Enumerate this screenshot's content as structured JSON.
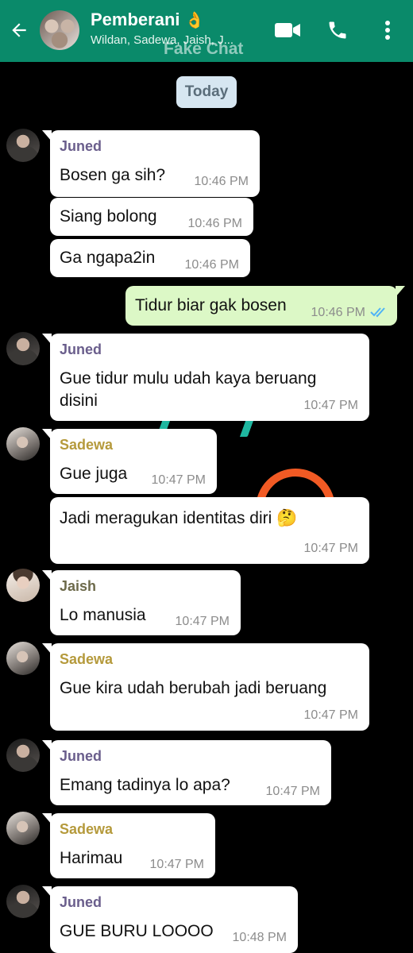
{
  "header": {
    "back_icon": "arrow-left-icon",
    "group_name": "Pemberani",
    "group_emoji": "👌",
    "members": "Wildan, Sadewa, Jaish, J...",
    "watermark": "Fake Chat",
    "icons": [
      "video-call-icon",
      "phone-icon",
      "more-vert-icon"
    ],
    "color": "#0a8a6a"
  },
  "date_chip": "Today",
  "messages": [
    {
      "sender": "Juned",
      "text": "Bosen ga sih?",
      "time": "10:46 PM"
    },
    {
      "text": "Siang bolong",
      "time": "10:46 PM"
    },
    {
      "text": "Ga ngapa2in",
      "time": "10:46 PM"
    },
    {
      "outgoing": true,
      "text": "Tidur biar gak bosen",
      "time": "10:46 PM",
      "status": "read"
    },
    {
      "sender": "Juned",
      "text_line1": "Gue tidur mulu udah kaya beruang",
      "text_line2": "disini",
      "time": "10:47 PM"
    },
    {
      "sender": "Sadewa",
      "text": "Gue juga",
      "time": "10:47 PM"
    },
    {
      "text": "Jadi meragukan identitas diri",
      "emoji": "🤔",
      "time": "10:47 PM"
    },
    {
      "sender": "Jaish",
      "text": "Lo manusia",
      "time": "10:47 PM"
    },
    {
      "sender": "Sadewa",
      "text": "Gue kira udah berubah jadi beruang",
      "time": "10:47 PM"
    },
    {
      "sender": "Juned",
      "text": "Emang tadinya lo apa?",
      "time": "10:47 PM"
    },
    {
      "sender": "Sadewa",
      "text": "Harimau",
      "time": "10:47 PM"
    },
    {
      "sender": "Juned",
      "text": "GUE BURU LOOOO",
      "time": "10:48 PM"
    }
  ]
}
